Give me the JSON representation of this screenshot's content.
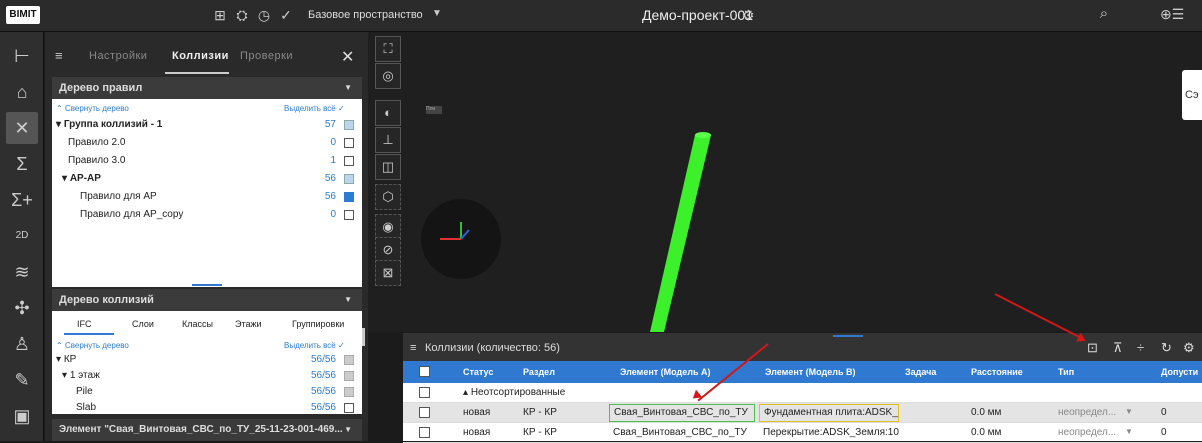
{
  "topbar": {
    "logo": "BIMIT",
    "space_label": "Базовое пространство",
    "project_name": "Демо-проект-001"
  },
  "panel": {
    "tabs": [
      "Настройки",
      "Коллизии",
      "Проверки"
    ],
    "active_tab": 1,
    "rules_tree": {
      "title": "Дерево правил",
      "collapse": "Свернуть дерево",
      "select_all": "Выделить всё",
      "rows": [
        {
          "label": "Группа коллизий - 1",
          "count": "57"
        },
        {
          "label": "Правило 2.0",
          "count": "0"
        },
        {
          "label": "Правило 3.0",
          "count": "1"
        },
        {
          "label": "АР-АР",
          "count": "56"
        },
        {
          "label": "Правило для АР",
          "count": "56"
        },
        {
          "label": "Правило для АР_copy",
          "count": "0"
        }
      ]
    },
    "collisions_tree": {
      "title": "Дерево коллизий",
      "subtabs": [
        "IFC",
        "Слои",
        "Классы",
        "Этажи",
        "Группировки"
      ],
      "collapse": "Свернуть дерево",
      "select_all": "Выделить всё",
      "rows": [
        {
          "label": "КР",
          "count": "56/56"
        },
        {
          "label": "1 этаж",
          "count": "56/56"
        },
        {
          "label": "Pile",
          "count": "56/56"
        },
        {
          "label": "Slab",
          "count": "56/56"
        }
      ]
    },
    "element_header": "Элемент \"Свая_Винтовая_СВС_по_ТУ_25-11-23-001-469..."
  },
  "collisions_table": {
    "title": "Коллизии (количество: 56)",
    "columns": [
      "Статус",
      "Раздел",
      "Элемент (Модель А)",
      "Элемент (Модель В)",
      "Задача",
      "Расстояние",
      "Тип",
      "Допусти"
    ],
    "group_label": "Неотсортированные",
    "rows": [
      {
        "status": "новая",
        "section": "КР - КР",
        "elem_a": "Свая_Винтовая_СВС_по_ТУ",
        "elem_b": "Фундаментная плита:ADSK_",
        "task": "",
        "distance": "0.0 мм",
        "type": "неопредел...",
        "allowed": "0"
      },
      {
        "status": "новая",
        "section": "КР - КР",
        "elem_a": "Свая_Винтовая_СВС_по_ТУ",
        "elem_b": "Перекрытие:ADSK_Земля:10",
        "task": "",
        "distance": "0.0 мм",
        "type": "неопредел...",
        "allowed": "0"
      }
    ]
  },
  "viewport": {
    "float_card_label": "Сэ",
    "small_tag": "Плн"
  },
  "colors": {
    "accent": "#2f7ad0",
    "model_green": "#3cf02c",
    "annotation_red": "#d01818"
  }
}
